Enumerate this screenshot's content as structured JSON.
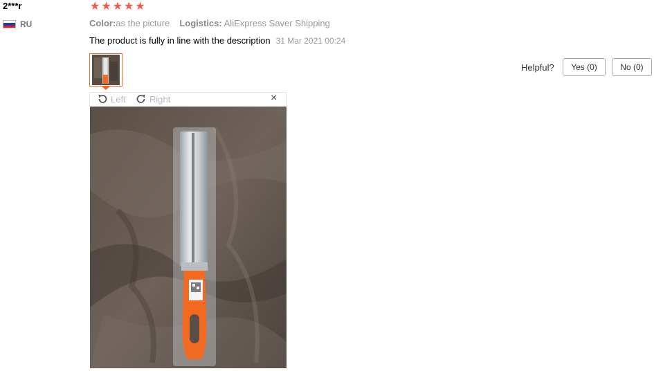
{
  "buyer": {
    "name": "2***r",
    "country": "RU",
    "flag_colors": [
      "#ffffff",
      "#1c3fa8",
      "#e02020"
    ]
  },
  "rating": {
    "stars": 5,
    "star_icon": "star-icon",
    "color": "#f2594b"
  },
  "attributes": {
    "color_label": "Color:",
    "color_value": "as the picture",
    "logistics_label": "Logistics:",
    "logistics_value": "AliExpress Saver Shipping"
  },
  "review": {
    "text": "The product is fully in line with the description",
    "date": "31 Mar 2021 00:24"
  },
  "helpful": {
    "label": "Helpful?",
    "yes_label": "Yes (0)",
    "no_label": "No (0)"
  },
  "viewer": {
    "rotate_left_label": "Left",
    "rotate_right_label": "Right",
    "close_glyph": "×",
    "accent": "#f26a21"
  }
}
